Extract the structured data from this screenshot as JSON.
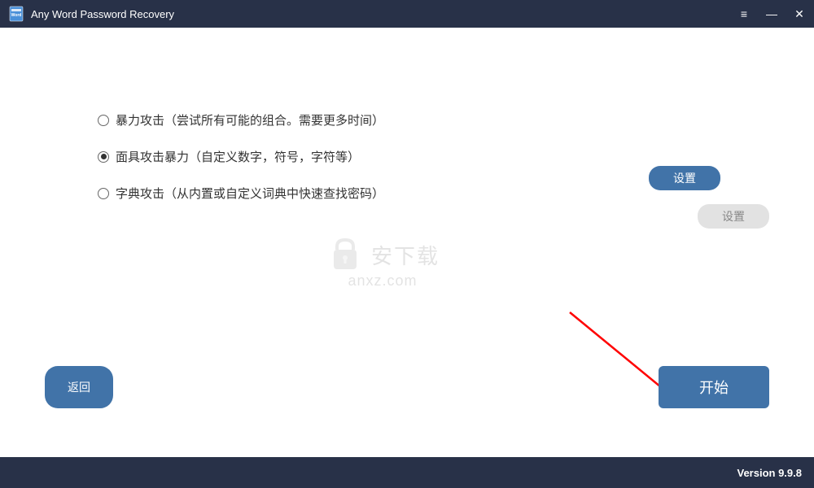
{
  "titlebar": {
    "title": "Any Word Password Recovery"
  },
  "options": {
    "brute_force": "暴力攻击（尝试所有可能的组合。需要更多时间）",
    "mask_attack": "面具攻击暴力（自定义数字，符号，字符等）",
    "dictionary": "字典攻击（从内置或自定义词典中快速查找密码）"
  },
  "buttons": {
    "settings_active": "设置",
    "settings_disabled": "设置",
    "back": "返回",
    "start": "开始"
  },
  "watermark": {
    "main": "安下载",
    "sub": "anxz.com"
  },
  "footer": {
    "version": "Version 9.9.8"
  }
}
